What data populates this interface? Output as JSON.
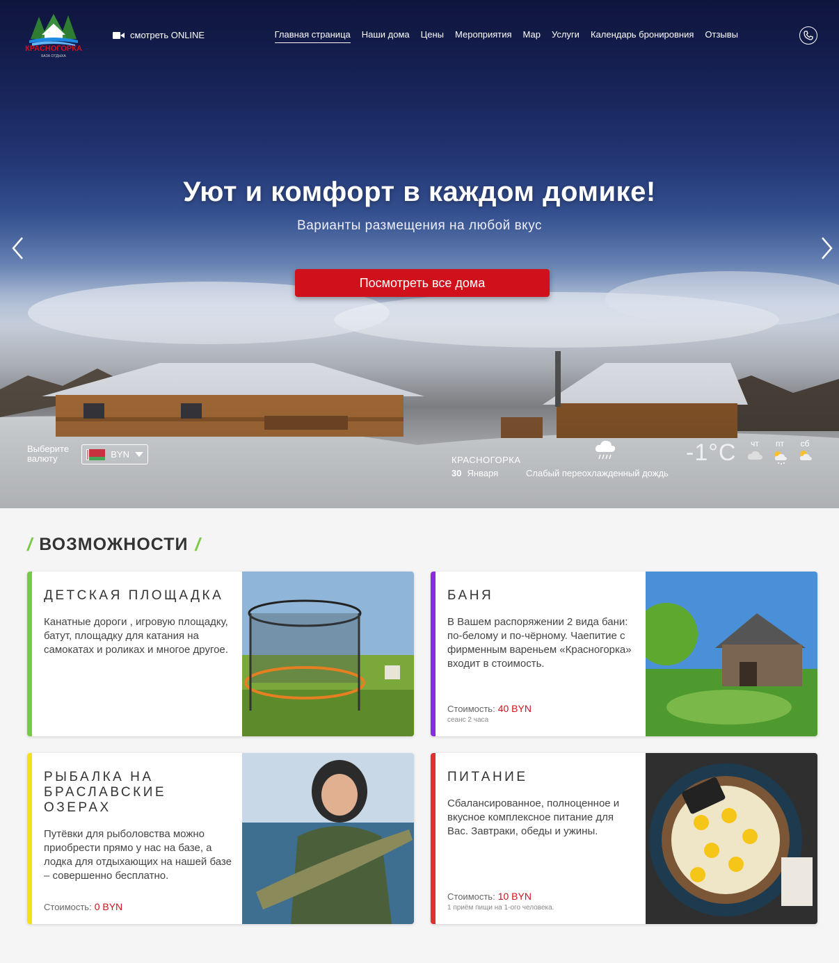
{
  "header": {
    "logo_alt": "КРАСНОГОРКА",
    "logo_sub": "БАЗА ОТДЫХА",
    "online_label": "смотреть ONLINE",
    "nav": [
      {
        "label": "Главная страница",
        "active": true
      },
      {
        "label": "Наши дома",
        "active": false
      },
      {
        "label": "Цены",
        "active": false
      },
      {
        "label": "Мероприятия",
        "active": false
      },
      {
        "label": "Мар",
        "active": false
      },
      {
        "label": "Услуги",
        "active": false
      },
      {
        "label": "Календарь бронировния",
        "active": false
      },
      {
        "label": "Отзывы",
        "active": false
      }
    ]
  },
  "hero": {
    "title": "Уют и комфорт в каждом домике!",
    "subtitle": "Варианты размещения на любой вкус",
    "button": "Посмотреть все дома"
  },
  "currency": {
    "label": "Выберите валюту",
    "selected": "BYN"
  },
  "weather": {
    "city": "КРАСНОГОРКА",
    "day": "30",
    "month": "Января",
    "description": "Слабый переохлажденный дождь",
    "temperature": "-1°C",
    "forecast": [
      {
        "day": "чт",
        "icon": "cloud-icon"
      },
      {
        "day": "пт",
        "icon": "sun-cloud-snow-icon"
      },
      {
        "day": "сб",
        "icon": "sun-cloud-icon"
      }
    ]
  },
  "features": {
    "title": "ВОЗМОЖНОСТИ",
    "cards": [
      {
        "title": "ДЕТСКАЯ ПЛОЩАДКА",
        "text": "Канатные дороги , игровую площадку, батут, площадку для катания на самокатах и роликах и многое другое.",
        "price_label": "",
        "price": "",
        "note": "",
        "color": "#7ac943"
      },
      {
        "title": "БАНЯ",
        "text": "В Вашем распоряжении 2 вида бани: по-белому и по-чёрному. Чаепитие с фирменным вареньем «Красногорка» входит в стоимость.",
        "price_label": "Стоимость:",
        "price": "40 BYN",
        "note": "сеанс 2 часа",
        "color": "#8a2be2"
      },
      {
        "title": "РЫБАЛКА НА БРАСЛАВСКИЕ ОЗЕРАХ",
        "text": "Путёвки для рыболовства можно приобрести прямо у нас на базе, а лодка для отдыхающих на нашей базе – совершенно бесплатно.",
        "price_label": "Стоимость:",
        "price": "0 BYN",
        "note": "",
        "color": "#f5e11a"
      },
      {
        "title": "ПИТАНИЕ",
        "text": "Сбалансированное, полноценное и вкусное комплексное питание для Вас. Завтраки, обеды и ужины.",
        "price_label": "Стоимость:",
        "price": "10 BYN",
        "note": "1 приём пищи на 1-ого человека.",
        "color": "#e03131"
      }
    ]
  },
  "colors": {
    "accent_red": "#d0111b",
    "section_slash": "#7ac943"
  }
}
